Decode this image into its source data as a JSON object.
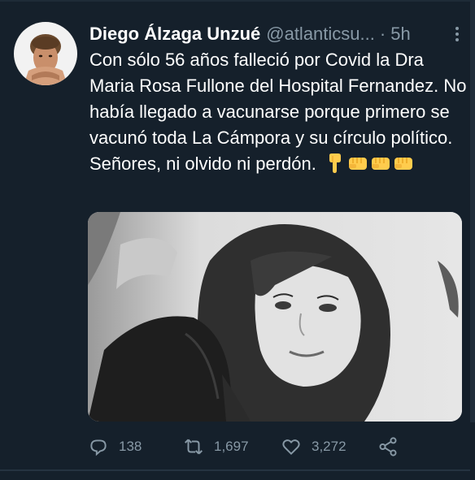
{
  "tweet": {
    "display_name": "Diego Álzaga Unzué",
    "handle": "@atlanticsu...",
    "separator": "·",
    "time": "5h",
    "text": "Con sólo 56 años falleció por Covid la Dra Maria Rosa Fullone del Hospital Fernandez. No había llegado a vacunarse porque primero se vacunó toda La Cámpora y su círculo político. Señores, ni olvido ni perdón.",
    "emojis": [
      "backhand-index-pointing-down",
      "oncoming-fist",
      "oncoming-fist",
      "oncoming-fist"
    ]
  },
  "actions": {
    "reply_count": "138",
    "retweet_count": "1,697",
    "like_count": "3,272"
  },
  "icons": {
    "reply": "reply-icon",
    "retweet": "retweet-icon",
    "like": "heart-icon",
    "share": "share-icon",
    "more": "more-options-icon"
  },
  "colors": {
    "background": "#15202b",
    "text_primary": "#ffffff",
    "text_secondary": "#8899a6"
  }
}
